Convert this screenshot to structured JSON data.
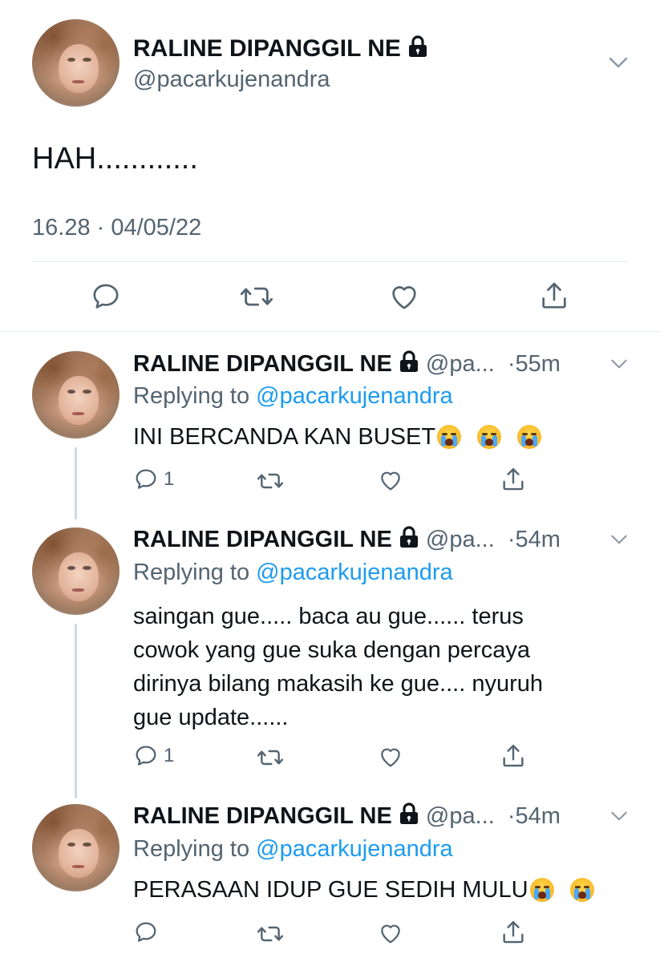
{
  "main_tweet": {
    "display_name": "RALINE DIPANGGIL NE",
    "handle": "@pacarkujenandra",
    "text": "HAH............",
    "timestamp": "16.28 · 04/05/22"
  },
  "replies": [
    {
      "display_name": "RALINE DIPANGGIL NE",
      "handle": "@pa...",
      "time": "·55m",
      "replying_prefix": "Replying to",
      "replying_to": "@pacarkujenandra",
      "text": "INI BERCANDA KAN BUSET",
      "emoji_count": 3,
      "reply_count": "1"
    },
    {
      "display_name": "RALINE DIPANGGIL NE",
      "handle": "@pa...",
      "time": "·54m",
      "replying_prefix": "Replying to",
      "replying_to": "@pacarkujenandra",
      "text_lines": [
        "saingan gue..... baca au gue...... terus",
        "cowok yang gue suka dengan percaya",
        "dirinya bilang makasih ke gue.... nyuruh",
        "gue update......"
      ],
      "reply_count": "1"
    },
    {
      "display_name": "RALINE DIPANGGIL NE",
      "handle": "@pa...",
      "time": "·54m",
      "replying_prefix": "Replying to",
      "replying_to": "@pacarkujenandra",
      "text": "PERASAAN IDUP GUE SEDIH MULU",
      "emoji_count": 2,
      "reply_count": ""
    }
  ],
  "icons": {
    "reply": "reply-icon",
    "retweet": "retweet-icon",
    "like": "heart-icon",
    "share": "share-icon",
    "more": "chevron-down-icon",
    "lock": "lock-icon",
    "emoji": "loudly-crying-face-emoji"
  },
  "colors": {
    "text": "#0f1419",
    "muted": "#536471",
    "link": "#1d9bf0",
    "divider": "#e6ecf0"
  }
}
